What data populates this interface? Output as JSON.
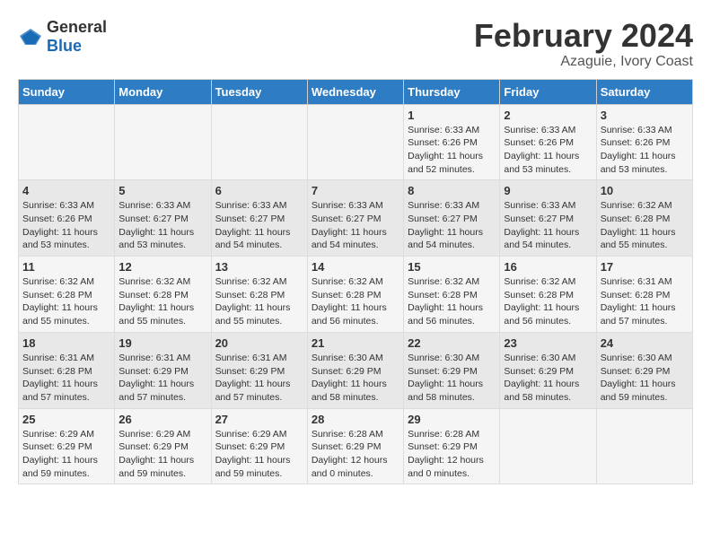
{
  "logo": {
    "general": "General",
    "blue": "Blue"
  },
  "title": "February 2024",
  "subtitle": "Azaguie, Ivory Coast",
  "weekdays": [
    "Sunday",
    "Monday",
    "Tuesday",
    "Wednesday",
    "Thursday",
    "Friday",
    "Saturday"
  ],
  "weeks": [
    [
      {
        "day": "",
        "detail": ""
      },
      {
        "day": "",
        "detail": ""
      },
      {
        "day": "",
        "detail": ""
      },
      {
        "day": "",
        "detail": ""
      },
      {
        "day": "1",
        "detail": "Sunrise: 6:33 AM\nSunset: 6:26 PM\nDaylight: 11 hours\nand 52 minutes."
      },
      {
        "day": "2",
        "detail": "Sunrise: 6:33 AM\nSunset: 6:26 PM\nDaylight: 11 hours\nand 53 minutes."
      },
      {
        "day": "3",
        "detail": "Sunrise: 6:33 AM\nSunset: 6:26 PM\nDaylight: 11 hours\nand 53 minutes."
      }
    ],
    [
      {
        "day": "4",
        "detail": "Sunrise: 6:33 AM\nSunset: 6:26 PM\nDaylight: 11 hours\nand 53 minutes."
      },
      {
        "day": "5",
        "detail": "Sunrise: 6:33 AM\nSunset: 6:27 PM\nDaylight: 11 hours\nand 53 minutes."
      },
      {
        "day": "6",
        "detail": "Sunrise: 6:33 AM\nSunset: 6:27 PM\nDaylight: 11 hours\nand 54 minutes."
      },
      {
        "day": "7",
        "detail": "Sunrise: 6:33 AM\nSunset: 6:27 PM\nDaylight: 11 hours\nand 54 minutes."
      },
      {
        "day": "8",
        "detail": "Sunrise: 6:33 AM\nSunset: 6:27 PM\nDaylight: 11 hours\nand 54 minutes."
      },
      {
        "day": "9",
        "detail": "Sunrise: 6:33 AM\nSunset: 6:27 PM\nDaylight: 11 hours\nand 54 minutes."
      },
      {
        "day": "10",
        "detail": "Sunrise: 6:32 AM\nSunset: 6:28 PM\nDaylight: 11 hours\nand 55 minutes."
      }
    ],
    [
      {
        "day": "11",
        "detail": "Sunrise: 6:32 AM\nSunset: 6:28 PM\nDaylight: 11 hours\nand 55 minutes."
      },
      {
        "day": "12",
        "detail": "Sunrise: 6:32 AM\nSunset: 6:28 PM\nDaylight: 11 hours\nand 55 minutes."
      },
      {
        "day": "13",
        "detail": "Sunrise: 6:32 AM\nSunset: 6:28 PM\nDaylight: 11 hours\nand 55 minutes."
      },
      {
        "day": "14",
        "detail": "Sunrise: 6:32 AM\nSunset: 6:28 PM\nDaylight: 11 hours\nand 56 minutes."
      },
      {
        "day": "15",
        "detail": "Sunrise: 6:32 AM\nSunset: 6:28 PM\nDaylight: 11 hours\nand 56 minutes."
      },
      {
        "day": "16",
        "detail": "Sunrise: 6:32 AM\nSunset: 6:28 PM\nDaylight: 11 hours\nand 56 minutes."
      },
      {
        "day": "17",
        "detail": "Sunrise: 6:31 AM\nSunset: 6:28 PM\nDaylight: 11 hours\nand 57 minutes."
      }
    ],
    [
      {
        "day": "18",
        "detail": "Sunrise: 6:31 AM\nSunset: 6:28 PM\nDaylight: 11 hours\nand 57 minutes."
      },
      {
        "day": "19",
        "detail": "Sunrise: 6:31 AM\nSunset: 6:29 PM\nDaylight: 11 hours\nand 57 minutes."
      },
      {
        "day": "20",
        "detail": "Sunrise: 6:31 AM\nSunset: 6:29 PM\nDaylight: 11 hours\nand 57 minutes."
      },
      {
        "day": "21",
        "detail": "Sunrise: 6:30 AM\nSunset: 6:29 PM\nDaylight: 11 hours\nand 58 minutes."
      },
      {
        "day": "22",
        "detail": "Sunrise: 6:30 AM\nSunset: 6:29 PM\nDaylight: 11 hours\nand 58 minutes."
      },
      {
        "day": "23",
        "detail": "Sunrise: 6:30 AM\nSunset: 6:29 PM\nDaylight: 11 hours\nand 58 minutes."
      },
      {
        "day": "24",
        "detail": "Sunrise: 6:30 AM\nSunset: 6:29 PM\nDaylight: 11 hours\nand 59 minutes."
      }
    ],
    [
      {
        "day": "25",
        "detail": "Sunrise: 6:29 AM\nSunset: 6:29 PM\nDaylight: 11 hours\nand 59 minutes."
      },
      {
        "day": "26",
        "detail": "Sunrise: 6:29 AM\nSunset: 6:29 PM\nDaylight: 11 hours\nand 59 minutes."
      },
      {
        "day": "27",
        "detail": "Sunrise: 6:29 AM\nSunset: 6:29 PM\nDaylight: 11 hours\nand 59 minutes."
      },
      {
        "day": "28",
        "detail": "Sunrise: 6:28 AM\nSunset: 6:29 PM\nDaylight: 12 hours\nand 0 minutes."
      },
      {
        "day": "29",
        "detail": "Sunrise: 6:28 AM\nSunset: 6:29 PM\nDaylight: 12 hours\nand 0 minutes."
      },
      {
        "day": "",
        "detail": ""
      },
      {
        "day": "",
        "detail": ""
      }
    ]
  ]
}
